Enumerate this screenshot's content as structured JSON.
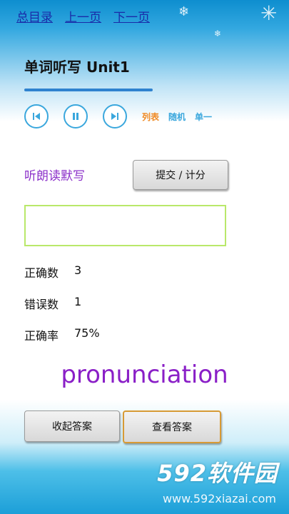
{
  "nav": {
    "home": "总目录",
    "prev": "上一页",
    "next": "下一页"
  },
  "header": {
    "title": "单词听写 Unit1"
  },
  "controls": {
    "modes": [
      "列表",
      "随机",
      "单一"
    ],
    "icons": [
      "skip-previous-icon",
      "pause-icon",
      "skip-next-icon"
    ],
    "accent": "#3aa7dd",
    "mode_active_color": "#f08a24"
  },
  "dictation": {
    "label": "听朗读默写",
    "submit_label": "提交 / 计分",
    "input_value": "",
    "input_placeholder": ""
  },
  "stats": {
    "correct_label": "正确数",
    "correct_value": "3",
    "wrong_label": "错误数",
    "wrong_value": "1",
    "rate_label": "正确率",
    "rate_value": "75%"
  },
  "answer": {
    "word": "pronunciation",
    "collapse_label": "收起答案",
    "view_label": "查看答案"
  },
  "watermark": {
    "brand": "592软件园",
    "url": "www.592xiazai.com"
  }
}
